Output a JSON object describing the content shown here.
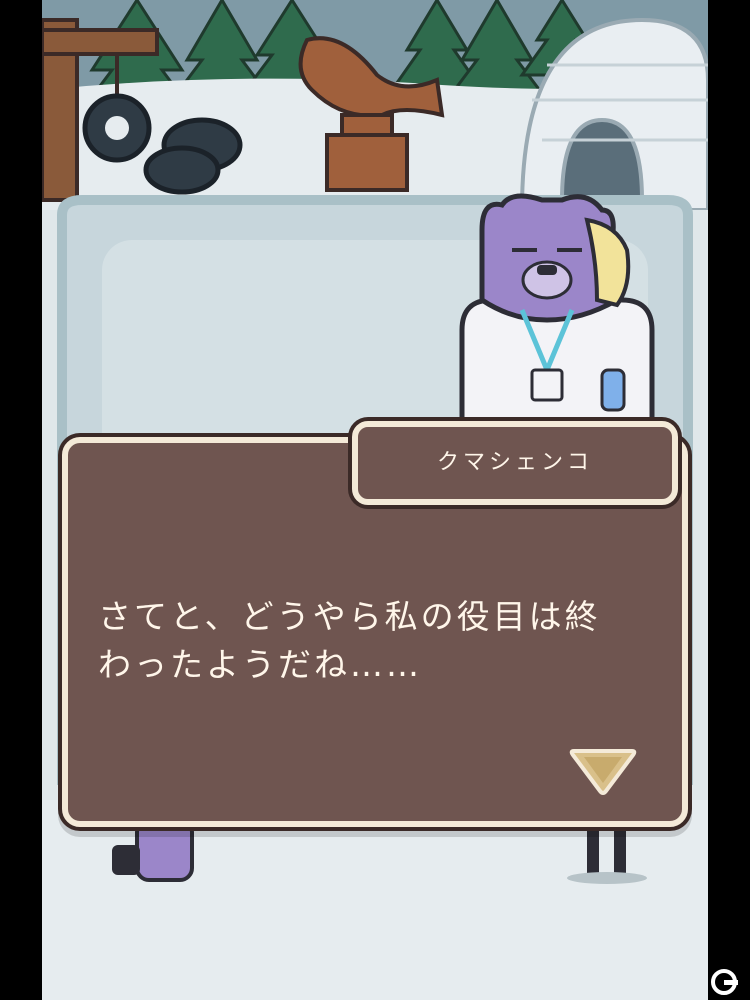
{
  "dialog": {
    "speaker": "クマシェンコ",
    "line1": "さてと、どうやら私の役目は終",
    "line2": "わったようだね……",
    "next_icon": "triangle-down-icon"
  },
  "colors": {
    "dialog_bg": "#6f5550",
    "dialog_border": "#f4ead8",
    "text": "#fff6ea",
    "snow": "#e6ecef",
    "ice": "#c7d6dc",
    "bear_purple": "#9b86c9",
    "jacket": "#f3f3f7"
  },
  "watermark": {
    "icon": "gamer-logo-icon"
  }
}
